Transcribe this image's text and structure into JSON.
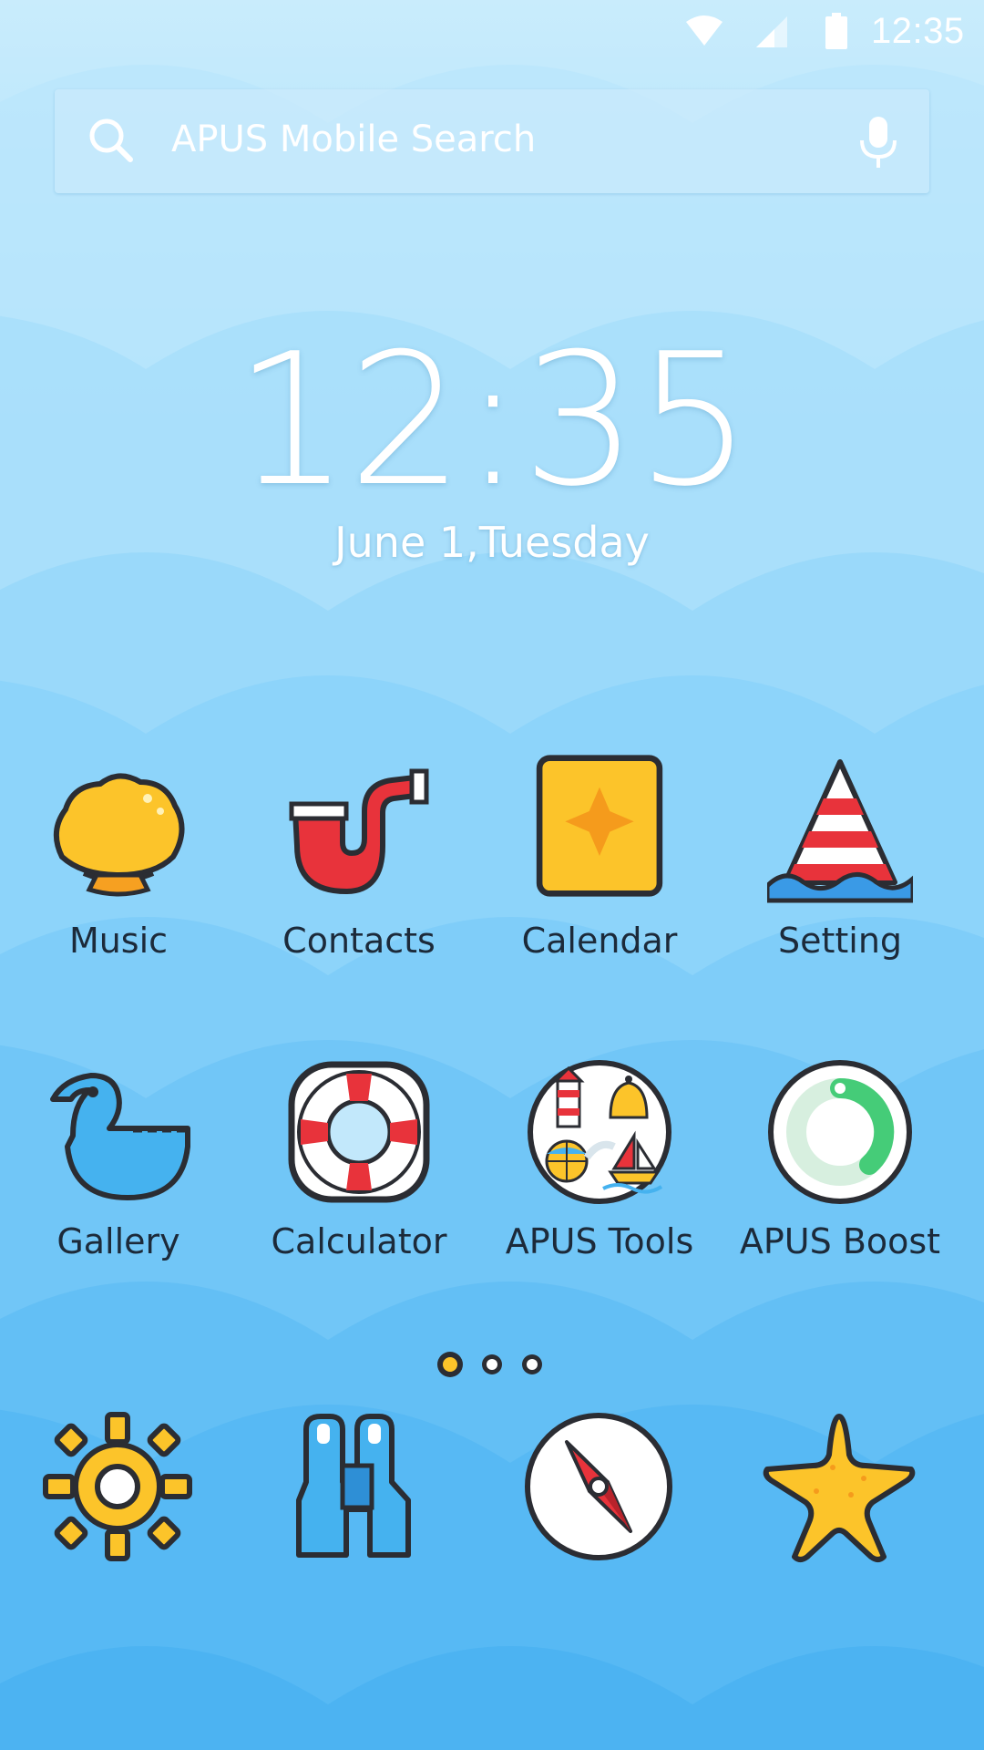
{
  "status_bar": {
    "time": "12:35",
    "icons": [
      "wifi-icon",
      "signal-icon",
      "battery-icon"
    ]
  },
  "search": {
    "placeholder": "APUS Mobile Search",
    "icon": "search-icon",
    "voice_icon": "microphone-icon"
  },
  "clock": {
    "time": "12:35",
    "date": "June 1,Tuesday"
  },
  "apps": [
    {
      "label": "Music",
      "icon": "shell-icon"
    },
    {
      "label": "Contacts",
      "icon": "pipe-icon"
    },
    {
      "label": "Calendar",
      "icon": "calendar-card-icon"
    },
    {
      "label": "Setting",
      "icon": "traffic-cone-icon"
    },
    {
      "label": "Gallery",
      "icon": "duck-icon"
    },
    {
      "label": "Calculator",
      "icon": "lifebuoy-icon"
    },
    {
      "label": "APUS Tools",
      "icon": "tools-folder-icon"
    },
    {
      "label": "APUS Boost",
      "icon": "boost-ring-icon"
    }
  ],
  "page_indicator": {
    "pages": 3,
    "current": 1
  },
  "dock": [
    {
      "icon": "sun-gear-icon"
    },
    {
      "icon": "binoculars-icon"
    },
    {
      "icon": "compass-icon"
    },
    {
      "icon": "starfish-icon"
    }
  ],
  "colors": {
    "sky_light": "#c6ebfc",
    "sky_mid": "#8fd6f9",
    "sky_deep": "#4fb9f2",
    "yellow": "#fcc42a",
    "red": "#e8333b",
    "blue": "#45b2ef",
    "green": "#45cc78",
    "outline": "#2b2d33",
    "label": "#1c2a3a"
  }
}
